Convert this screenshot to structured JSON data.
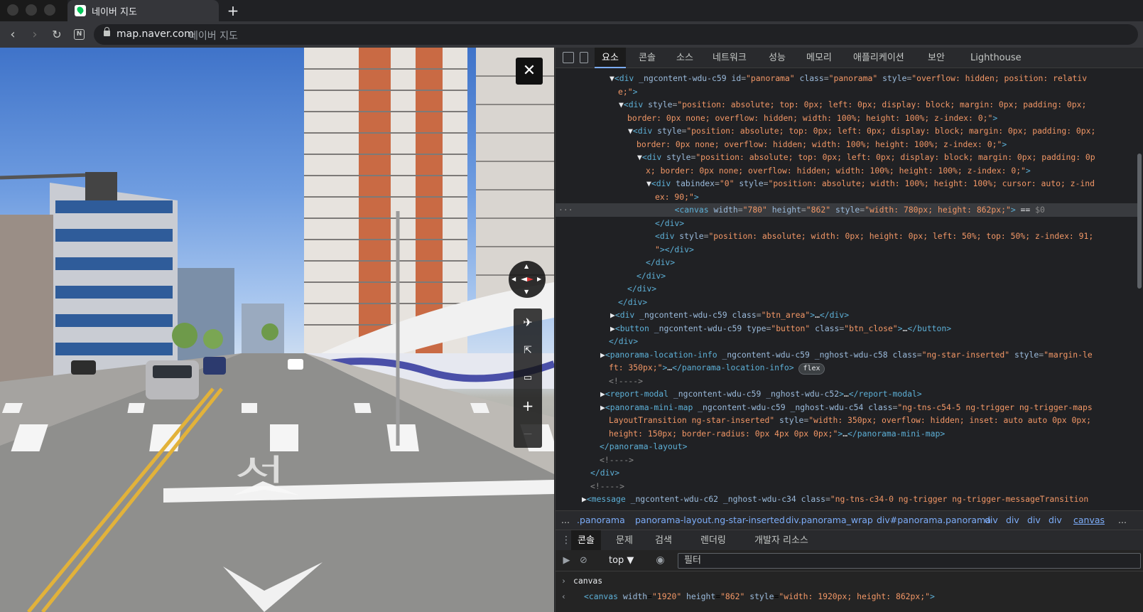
{
  "browser": {
    "tab_title": "네이버 지도",
    "url": "map.naver.com",
    "url_title": "네이버 지도"
  },
  "colors": {
    "accent": "#7cacf8",
    "brand": "#03c75a",
    "tag": "#5db0d7",
    "attr_value": "#f29766"
  },
  "street_view": {
    "close_label": "✕",
    "tools": [
      {
        "icon": "airplane-icon",
        "glyph": "✈"
      },
      {
        "icon": "share-icon",
        "glyph": "⇱"
      },
      {
        "icon": "report-icon",
        "glyph": "▭"
      },
      {
        "icon": "zoom-in-icon",
        "glyph": "+"
      },
      {
        "icon": "zoom-out-icon",
        "glyph": "—"
      }
    ],
    "road_marking": "서"
  },
  "devtools": {
    "tabs": [
      "요소",
      "콘솔",
      "소스",
      "네트워크",
      "성능",
      "메모리",
      "애플리케이션",
      "보안",
      "Lighthouse"
    ],
    "active_tab": "요소",
    "breadcrumbs": [
      "...",
      ".panorama",
      "panorama-layout.ng-star-inserted",
      "div.panorama_wrap",
      "div#panorama.panorama",
      "div",
      "div",
      "div",
      "div",
      "canvas",
      "..."
    ],
    "drawer_tabs": [
      "콘솔",
      "문제",
      "검색",
      "렌더링",
      "개발자 리소스"
    ],
    "console_context": "top ▼",
    "filter_placeholder": "필터",
    "console_input": "canvas",
    "console_output_tag": "<canvas",
    "console_output_w_attr": "width",
    "console_output_w_val": "\"1920\"",
    "console_output_h_attr": "height",
    "console_output_h_val": "\"862\"",
    "console_output_s_attr": "style",
    "console_output_s_val": "\"width: 1920px; height: 862px;\"",
    "console_output_end": ">",
    "flex_badge": "flex"
  }
}
